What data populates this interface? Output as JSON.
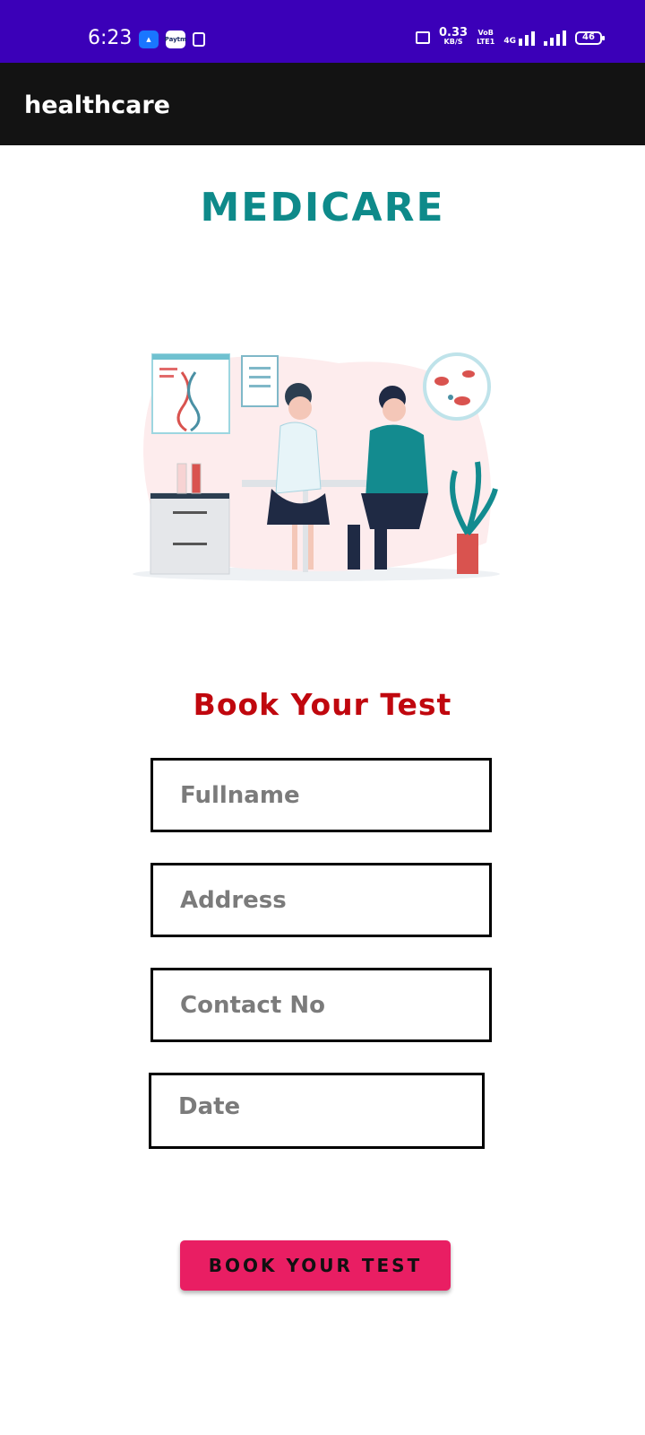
{
  "status_bar": {
    "time": "6:23",
    "paytm_label": "Paytm",
    "speed_value": "0.33",
    "speed_unit": "KB/S",
    "volte_top": "VoB",
    "volte_bottom": "LTE1",
    "network": "4G",
    "battery": "46"
  },
  "app_bar": {
    "title": "healthcare"
  },
  "brand": {
    "title": "MEDICARE"
  },
  "form": {
    "heading": "Book  Your Test",
    "fullname_placeholder": "Fullname",
    "address_placeholder": "Address",
    "contact_placeholder": "Contact No",
    "date_placeholder": "Date",
    "submit_label": "BOOK YOUR TEST"
  },
  "colors": {
    "status_bar": "#3b00b8",
    "app_bar": "#131313",
    "brand": "#0e8a8a",
    "heading": "#c0070e",
    "button": "#e91e63"
  }
}
